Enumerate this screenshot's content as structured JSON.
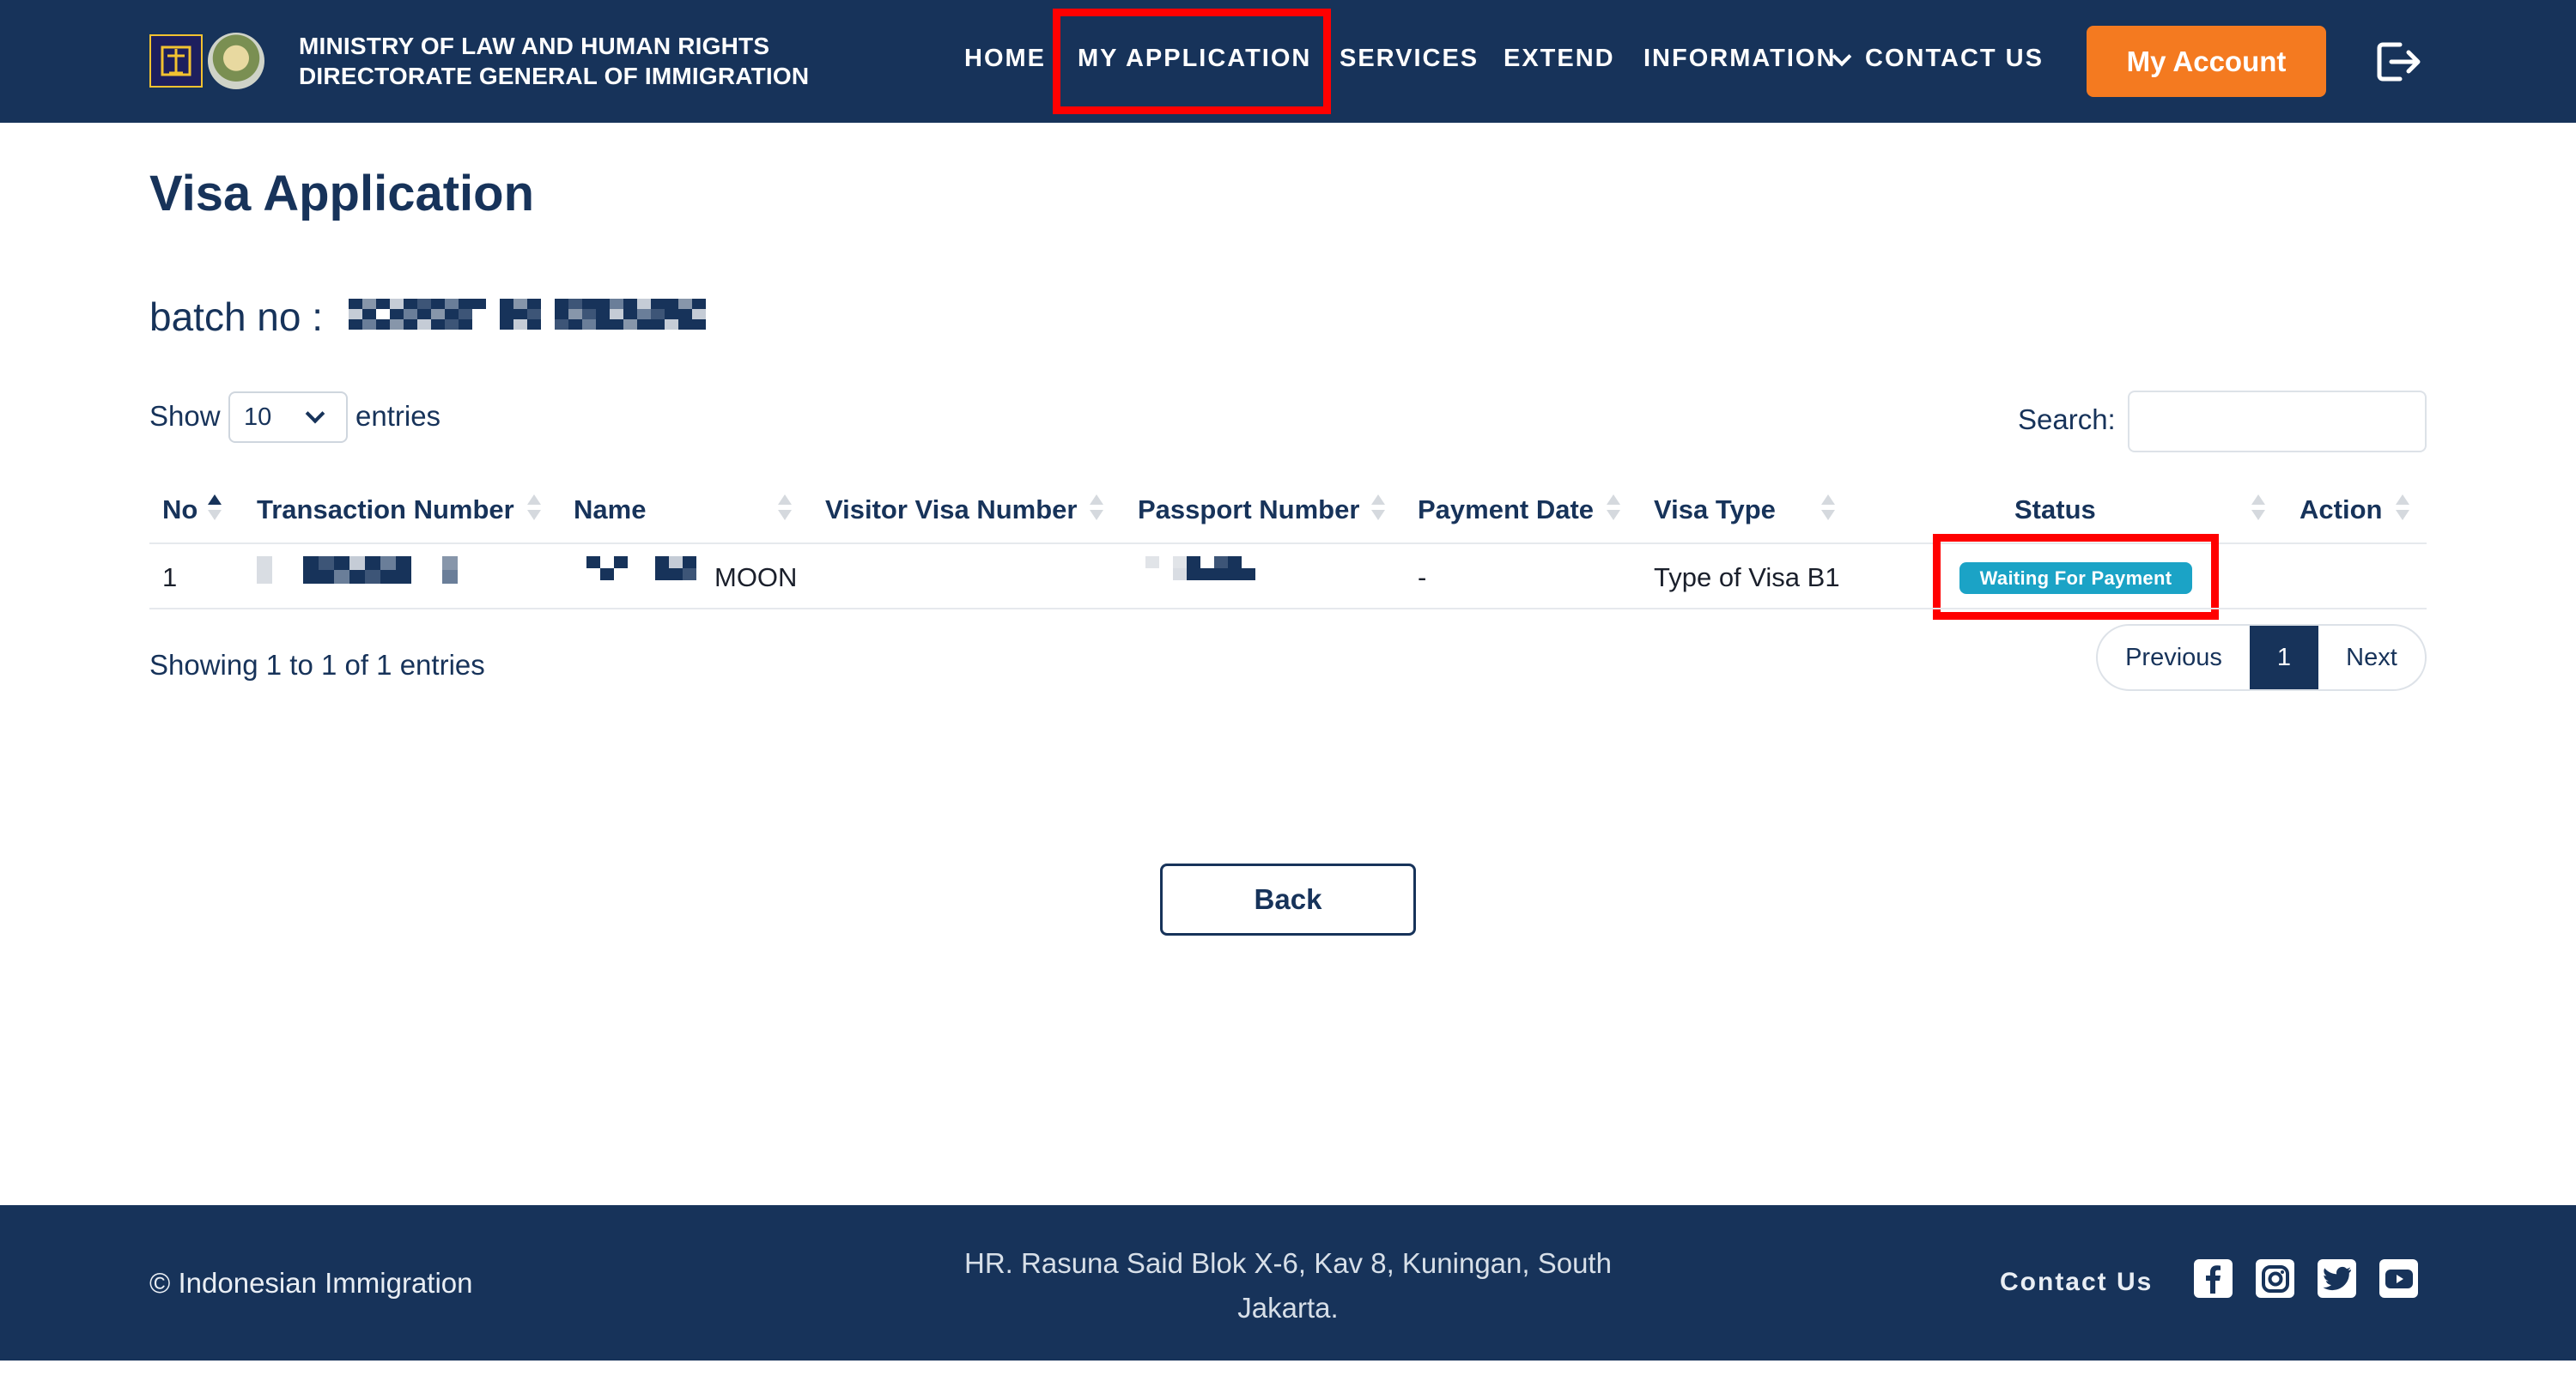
{
  "header": {
    "org_line1": "MINISTRY OF  LAW  AND HUMAN RIGHTS",
    "org_line2": "DIRECTORATE GENERAL OF IMMIGRATION",
    "nav": {
      "home": "HOME",
      "my_application": "MY APPLICATION",
      "services": "SERVICES",
      "extend": "EXTEND",
      "information": "INFORMATION",
      "contact": "CONTACT US"
    },
    "account_button": "My Account",
    "colors": {
      "bar": "#17335a",
      "accent": "#f47a20",
      "highlight": "#ff0000"
    }
  },
  "main": {
    "title": "Visa Application",
    "batch_label": "batch no :",
    "show_label": "Show",
    "page_size": "10",
    "entries_label": "entries",
    "search_label": "Search:",
    "search_placeholder": "",
    "columns": [
      "No",
      "Transaction Number",
      "Name",
      "Visitor Visa Number",
      "Passport Number",
      "Payment Date",
      "Visa Type",
      "Status",
      "Action"
    ],
    "rows": [
      {
        "no": "1",
        "name_suffix": "MOON",
        "visitor_visa_number": "",
        "payment_date": "-",
        "visa_type": "Type of Visa B1",
        "status": "Waiting For Payment",
        "status_color": "#1ba3c6"
      }
    ],
    "showing": "Showing 1 to 1 of 1 entries",
    "pager": {
      "previous": "Previous",
      "current": "1",
      "next": "Next"
    },
    "back_button": "Back"
  },
  "footer": {
    "copyright": "© Indonesian Immigration",
    "address_line1": "HR. Rasuna Said Blok X-6, Kav 8, Kuningan, South",
    "address_line2": "Jakarta.",
    "contact": "Contact Us",
    "social_icons": [
      "facebook-icon",
      "instagram-icon",
      "twitter-icon",
      "youtube-icon"
    ]
  }
}
